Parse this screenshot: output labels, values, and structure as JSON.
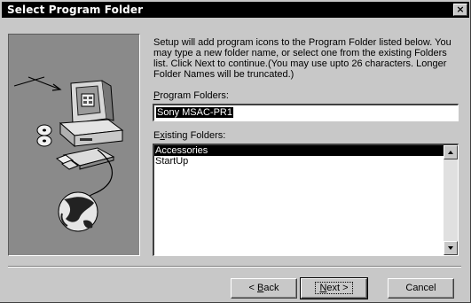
{
  "window": {
    "title": "Select Program Folder",
    "close_glyph": "×"
  },
  "description": "Setup will add program icons to the Program Folder listed below.  You may type a new folder name, or select one from the existing Folders list.  Click Next to continue.(You may use upto 26 characters. Longer Folder Names will be truncated.)",
  "program_folders": {
    "label_accel": "P",
    "label_rest": "rogram Folders:",
    "value": "Sony MSAC-PR1"
  },
  "existing_folders": {
    "label_pre": "E",
    "label_accel": "x",
    "label_rest": "isting Folders:",
    "items": [
      "Accessories",
      "StartUp"
    ],
    "selected_index": 0
  },
  "buttons": {
    "back_pre": "< ",
    "back_accel": "B",
    "back_rest": "ack",
    "next_accel": "N",
    "next_rest": "ext >",
    "cancel": "Cancel"
  },
  "icons": {
    "art": "setup-computer-globe-illustration",
    "scroll_up": "scroll-up-arrow-icon",
    "scroll_down": "scroll-down-arrow-icon"
  }
}
